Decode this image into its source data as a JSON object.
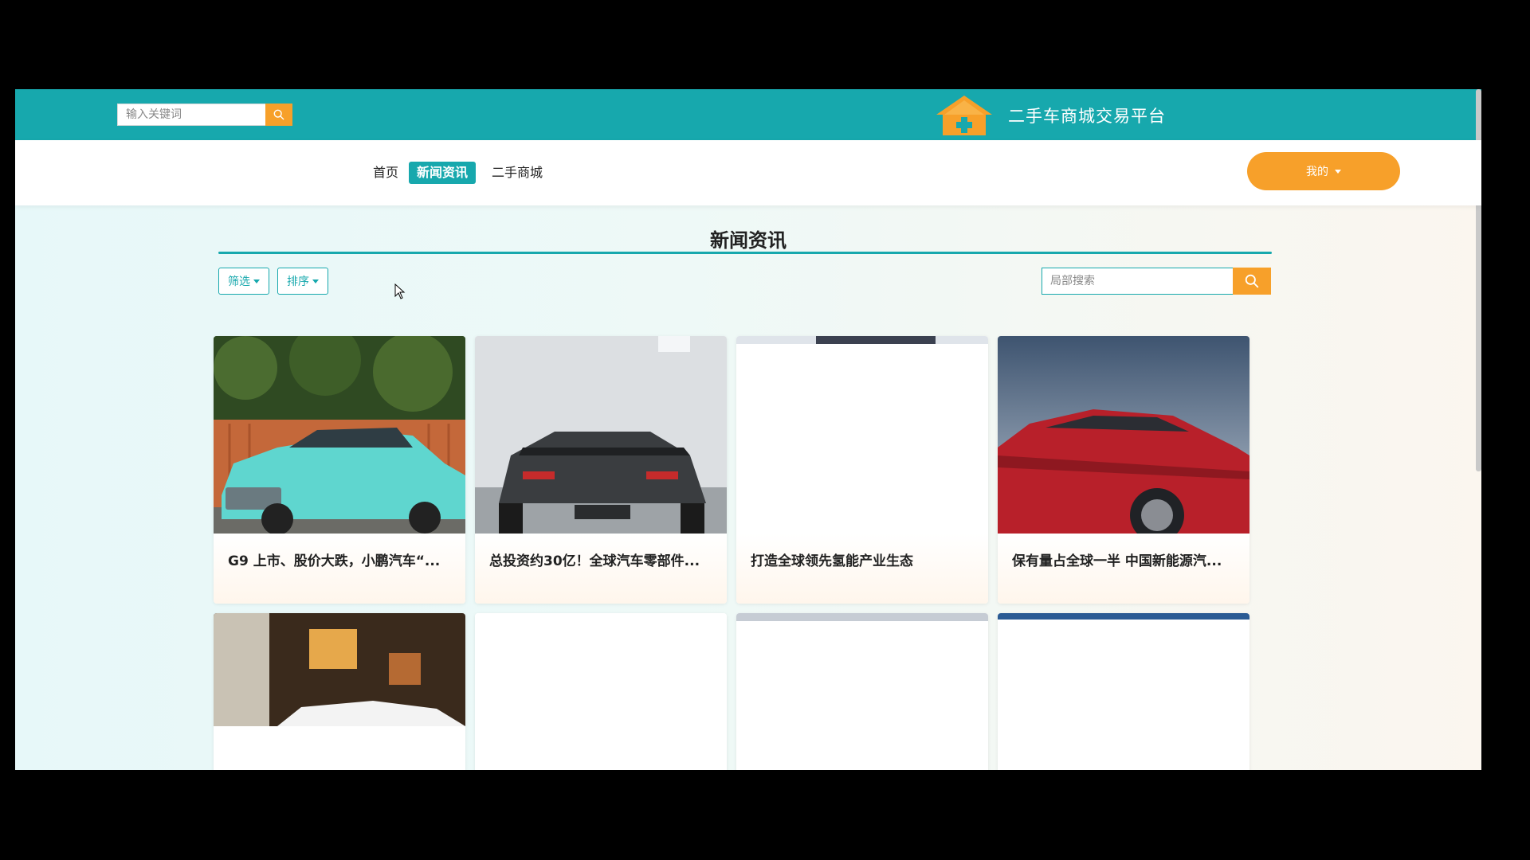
{
  "header": {
    "search_placeholder": "输入关键词",
    "brand_title": "二手车商城交易平台"
  },
  "nav": {
    "items": [
      {
        "label": "首页",
        "active": false
      },
      {
        "label": "新闻资讯",
        "active": true
      },
      {
        "label": "二手商城",
        "active": false
      }
    ],
    "mine_label": "我的"
  },
  "section": {
    "title": "新闻资讯",
    "filter_label": "筛选",
    "sort_label": "排序",
    "local_search_placeholder": "局部搜索"
  },
  "news": [
    {
      "title": "G9 上市、股价大跌，小鹏汽车“..."
    },
    {
      "title": "总投资约30亿！全球汽车零部件..."
    },
    {
      "title": "打造全球领先氢能产业生态"
    },
    {
      "title": "保有量占全球一半 中国新能源汽..."
    },
    {
      "title": ""
    },
    {
      "title": ""
    },
    {
      "title": ""
    },
    {
      "title": ""
    }
  ],
  "colors": {
    "primary": "#17a8ad",
    "accent": "#f7a02a"
  },
  "icons": {
    "search": "search-icon",
    "logo": "house-plus-logo",
    "dropdown": "caret-down-icon"
  }
}
